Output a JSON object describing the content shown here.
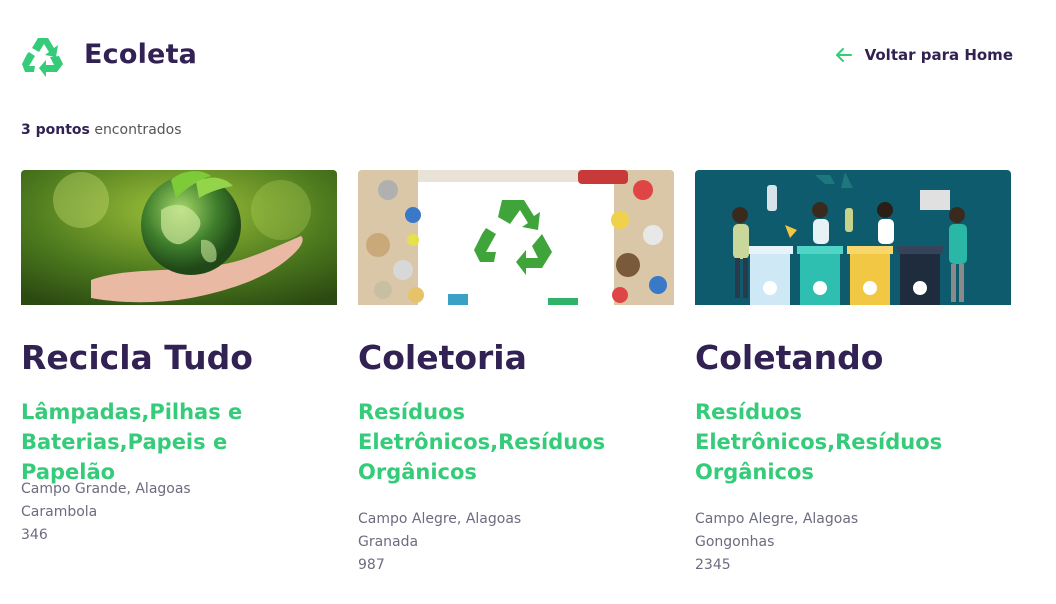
{
  "app": {
    "name": "Ecoleta",
    "back_label": "Voltar para Home",
    "accent": "#34CB79",
    "title_color": "#322153",
    "text_color": "#6C6C80"
  },
  "results": {
    "count_bold": "3 pontos",
    "count_rest": " encontrados"
  },
  "points": [
    {
      "name": "Recicla Tudo",
      "items": "Lâmpadas,Pilhas e Baterias,Papeis e Papelão",
      "city_uf": "Campo Grande, Alagoas",
      "district": "Carambola",
      "number": "346"
    },
    {
      "name": "Coletoria",
      "items": "Resíduos Eletrônicos,Resíduos Orgânicos",
      "city_uf": "Campo Alegre, Alagoas",
      "district": "Granada",
      "number": "987"
    },
    {
      "name": "Coletando",
      "items": "Resíduos Eletrônicos,Resíduos Orgânicos",
      "city_uf": "Campo Alegre, Alagoas",
      "district": "Gongonhas",
      "number": "2345"
    }
  ]
}
